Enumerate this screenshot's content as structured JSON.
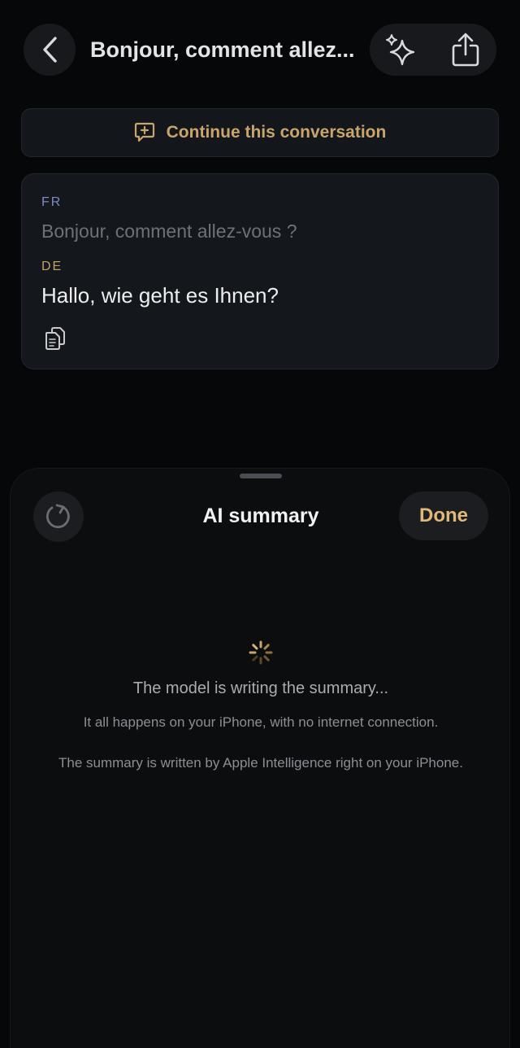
{
  "header": {
    "title": "Bonjour, comment allez...",
    "icons": {
      "back": "chevron-left-icon",
      "sparkle": "sparkles-icon",
      "share": "share-icon"
    }
  },
  "continue_button": {
    "label": "Continue this conversation",
    "icon": "chat-plus-icon"
  },
  "translation": {
    "source_lang": "FR",
    "source_text": "Bonjour, comment allez-vous ?",
    "target_lang": "DE",
    "target_text": "Hallo, wie geht es Ihnen?",
    "copy_icon": "copy-icon"
  },
  "sheet": {
    "title": "AI summary",
    "done_label": "Done",
    "refresh_icon": "refresh-icon",
    "status_main": "The model is writing the summary...",
    "status_sub": "It all happens on your iPhone, with no internet connection.",
    "status_note": "The summary is written by Apple Intelligence right on your iPhone."
  },
  "colors": {
    "background": "#060708",
    "accent": "#c9a56b",
    "done_accent": "#e0b877",
    "source_lang": "#7d8bc4",
    "target_lang": "#c0a262"
  }
}
